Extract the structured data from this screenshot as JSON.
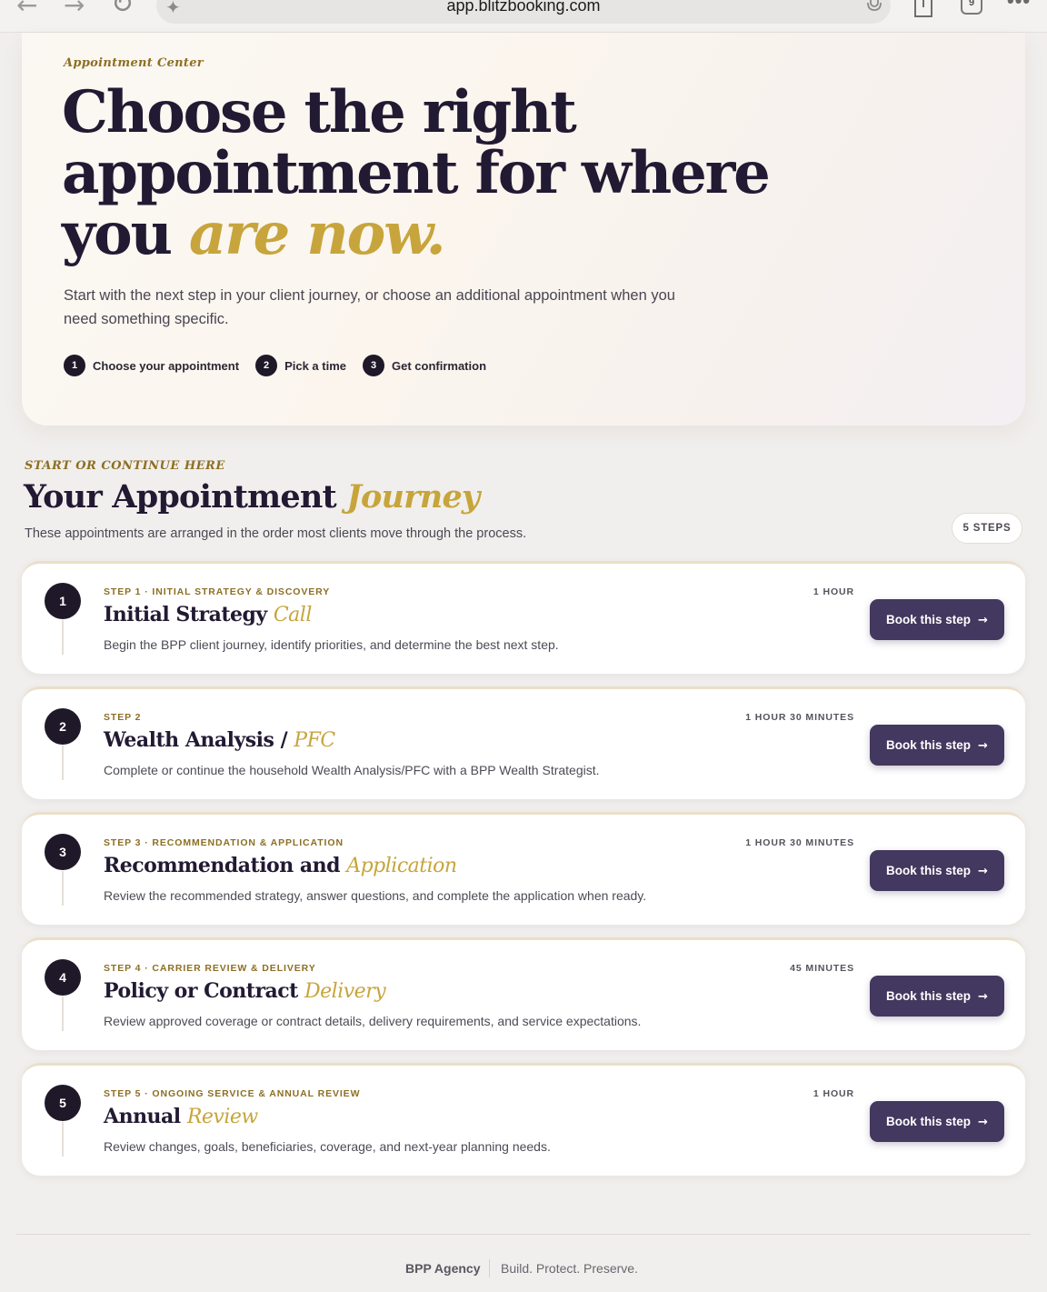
{
  "browser": {
    "back_icon": "←",
    "forward_icon": "→",
    "reload_icon": "↻",
    "sparkle_icon": "✦",
    "url": "app.blitzbooking.com",
    "tab_count": "9",
    "more_icon": "•••"
  },
  "hero": {
    "eyebrow": "Appointment Center",
    "title_main": "Choose the right appointment for where you ",
    "title_accent": "are now.",
    "subtitle": "Start with the next step in your client journey, or choose an additional appointment when you need something specific.",
    "steps": [
      {
        "number": "1",
        "label": "Choose your appointment"
      },
      {
        "number": "2",
        "label": "Pick a time"
      },
      {
        "number": "3",
        "label": "Get confirmation"
      }
    ]
  },
  "journey": {
    "eyebrow": "START OR CONTINUE HERE",
    "title_main": "Your Appointment ",
    "title_accent": "Journey",
    "subtitle": "These appointments are arranged in the order most clients move through the process.",
    "count_badge": "5 STEPS",
    "cards": [
      {
        "number": "1",
        "eyebrow": "STEP 1 · INITIAL STRATEGY & DISCOVERY",
        "title_main": "Initial Strategy ",
        "title_accent": "Call",
        "description": "Begin the BPP client journey, identify priorities, and determine the best next step.",
        "duration": "1 HOUR",
        "button": "Book this step"
      },
      {
        "number": "2",
        "eyebrow": "STEP 2",
        "title_main": "Wealth Analysis / ",
        "title_accent": "PFC",
        "description": "Complete or continue the household Wealth Analysis/PFC with a BPP Wealth Strategist.",
        "duration": "1 HOUR 30 MINUTES",
        "button": "Book this step"
      },
      {
        "number": "3",
        "eyebrow": "STEP 3 · RECOMMENDATION & APPLICATION",
        "title_main": "Recommendation and ",
        "title_accent": "Application",
        "description": "Review the recommended strategy, answer questions, and complete the application when ready.",
        "duration": "1 HOUR 30 MINUTES",
        "button": "Book this step"
      },
      {
        "number": "4",
        "eyebrow": "STEP 4 · CARRIER REVIEW & DELIVERY",
        "title_main": "Policy or Contract ",
        "title_accent": "Delivery",
        "description": "Review approved coverage or contract details, delivery requirements, and service expectations.",
        "duration": "45 MINUTES",
        "button": "Book this step"
      },
      {
        "number": "5",
        "eyebrow": "STEP 5 · ONGOING SERVICE & ANNUAL REVIEW",
        "title_main": "Annual ",
        "title_accent": "Review",
        "description": "Review changes, goals, beneficiaries, coverage, and next-year planning needs.",
        "duration": "1 HOUR",
        "button": "Book this step"
      }
    ]
  },
  "footer": {
    "brand": "BPP Agency",
    "tagline": "Build. Protect. Preserve."
  },
  "colors": {
    "accent_gold": "#c7a53c",
    "eyebrow_gold": "#8d6f23",
    "ink": "#221a33",
    "button_purple": "#43385f"
  }
}
